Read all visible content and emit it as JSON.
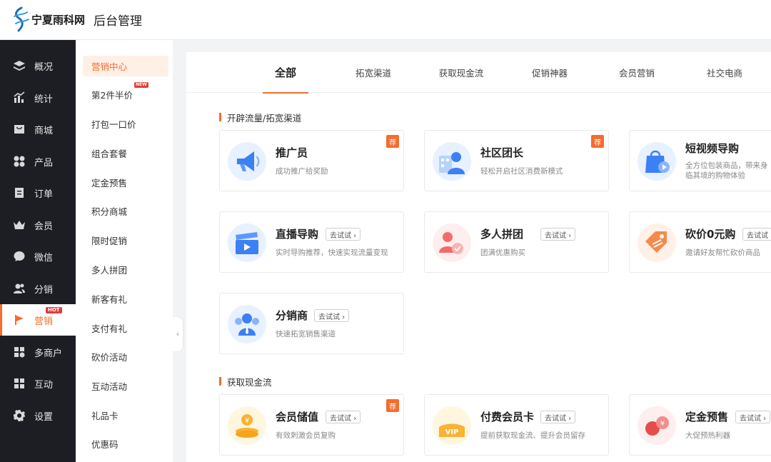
{
  "header": {
    "logo_text": "宁夏雨科网",
    "title": "后台管理"
  },
  "sidebar": {
    "items": [
      {
        "label": "概况",
        "icon": "layers-icon"
      },
      {
        "label": "统计",
        "icon": "chart-icon"
      },
      {
        "label": "商城",
        "icon": "shop-icon"
      },
      {
        "label": "产品",
        "icon": "grid-icon"
      },
      {
        "label": "订单",
        "icon": "order-icon"
      },
      {
        "label": "会员",
        "icon": "crown-icon"
      },
      {
        "label": "微信",
        "icon": "wechat-icon"
      },
      {
        "label": "分销",
        "icon": "users-icon"
      },
      {
        "label": "营销",
        "icon": "flag-icon",
        "badge": "HOT",
        "active": true
      },
      {
        "label": "多商户",
        "icon": "store-plus-icon"
      },
      {
        "label": "互动",
        "icon": "apps-icon"
      },
      {
        "label": "设置",
        "icon": "gear-icon"
      }
    ]
  },
  "subnav": {
    "items": [
      {
        "label": "营销中心",
        "active": true
      },
      {
        "label": "第2件半价",
        "badge": "NEW"
      },
      {
        "label": "打包一口价"
      },
      {
        "label": "组合套餐"
      },
      {
        "label": "定金预售"
      },
      {
        "label": "积分商城"
      },
      {
        "label": "限时促销"
      },
      {
        "label": "多人拼团"
      },
      {
        "label": "新客有礼"
      },
      {
        "label": "支付有礼"
      },
      {
        "label": "砍价活动"
      },
      {
        "label": "互动活动"
      },
      {
        "label": "礼品卡"
      },
      {
        "label": "优惠码"
      }
    ],
    "collapse_glyph": "‹"
  },
  "tabs": [
    {
      "label": "全部",
      "active": true
    },
    {
      "label": "拓宽渠道"
    },
    {
      "label": "获取现金流"
    },
    {
      "label": "促销神器"
    },
    {
      "label": "会员营销"
    },
    {
      "label": "社交电商"
    }
  ],
  "sections": [
    {
      "title": "开辟流量/拓宽渠道",
      "cards": [
        {
          "title": "推广员",
          "desc": "成功推广给奖励",
          "rec": "荐",
          "icon": "megaphone-icon"
        },
        {
          "title": "社区团长",
          "desc": "轻松开启社区消费新模式",
          "rec": "荐",
          "icon": "community-leader-icon"
        },
        {
          "title": "短视频导购",
          "desc": "全方位包装商品，带来身临其境的购物体验",
          "icon": "video-bag-icon"
        },
        {
          "title": "直播导购",
          "desc": "实时导购推荐，快速实现流量变现",
          "try": "去试试 ›",
          "icon": "clapper-icon"
        },
        {
          "title": "多人拼团",
          "desc": "团满优惠购买",
          "try": "去试试 ›",
          "icon": "group-buy-icon"
        },
        {
          "title": "砍价0元购",
          "desc": "邀请好友帮忙砍价商品",
          "try": "去试试 ›",
          "icon": "price-tag-icon"
        },
        {
          "title": "分销商",
          "desc": "快速拓宽销售渠道",
          "try": "去试试 ›",
          "icon": "distributor-icon"
        }
      ]
    },
    {
      "title": "获取现金流",
      "cards": [
        {
          "title": "会员储值",
          "desc": "有效刺激会员复购",
          "try": "去试试 ›",
          "rec": "荐",
          "icon": "coin-stack-icon"
        },
        {
          "title": "付费会员卡",
          "desc": "提前获取现金流、提升会员留存",
          "try": "去试试 ›",
          "icon": "vip-card-icon"
        },
        {
          "title": "定金预售",
          "desc": "大促预热利器",
          "try": "去试试 ›",
          "icon": "deposit-icon"
        }
      ]
    }
  ],
  "colors": {
    "accent": "#f56c2d",
    "sidebar_bg": "#1d1e23",
    "badge_red": "#e03d3d"
  }
}
